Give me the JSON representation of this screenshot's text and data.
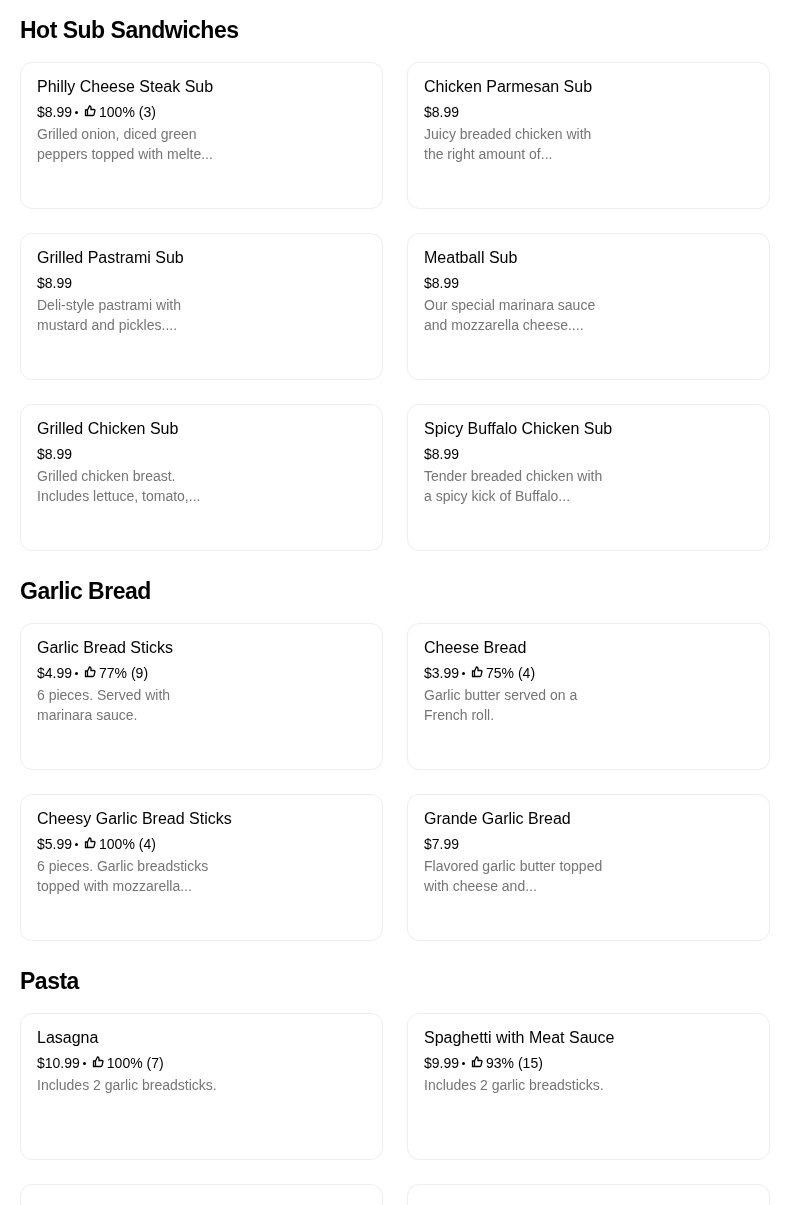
{
  "sections": [
    {
      "title": "Hot Sub Sandwiches",
      "items": [
        {
          "kind": "full",
          "name": "Philly Cheese Steak Sub",
          "price": "$8.99",
          "rating": "100% (3)",
          "description": "Grilled onion, diced green peppers topped with melte..."
        },
        {
          "kind": "full",
          "name": "Chicken Parmesan Sub",
          "price": "$8.99",
          "description": "Juicy breaded chicken with the right amount of..."
        },
        {
          "kind": "full",
          "name": "Grilled Pastrami Sub",
          "price": "$8.99",
          "description": "Deli-style pastrami with mustard and pickles...."
        },
        {
          "kind": "full",
          "name": "Meatball Sub",
          "price": "$8.99",
          "description": "Our special marinara sauce and mozzarella cheese...."
        },
        {
          "kind": "full",
          "name": "Grilled Chicken Sub",
          "price": "$8.99",
          "description": "Grilled chicken breast. Includes lettuce, tomato,..."
        },
        {
          "kind": "full",
          "name": "Spicy Buffalo Chicken Sub",
          "price": "$8.99",
          "description": "Tender breaded chicken with a spicy kick of Buffalo..."
        }
      ]
    },
    {
      "title": "Garlic Bread",
      "items": [
        {
          "kind": "full",
          "name": "Garlic Bread Sticks",
          "price": "$4.99",
          "rating": "77% (9)",
          "description": "6 pieces. Served with marinara sauce."
        },
        {
          "kind": "full",
          "name": "Cheese Bread",
          "price": "$3.99",
          "rating": "75% (4)",
          "description": "Garlic butter served on a French roll."
        },
        {
          "kind": "full",
          "name": "Cheesy Garlic Bread Sticks",
          "price": "$5.99",
          "rating": "100% (4)",
          "description": "6 pieces. Garlic breadsticks topped with mozzarella..."
        },
        {
          "kind": "full",
          "name": "Grande Garlic Bread",
          "price": "$7.99",
          "description": "Flavored garlic butter topped with cheese and..."
        }
      ]
    },
    {
      "title": "Pasta",
      "items": [
        {
          "kind": "full",
          "name": "Lasagna",
          "price": "$10.99",
          "rating": "100% (7)",
          "description": "Includes 2 garlic breadsticks."
        },
        {
          "kind": "full",
          "name": "Spaghetti with Meat Sauce",
          "price": "$9.99",
          "rating": "93% (15)",
          "description": "Includes 2 garlic breadsticks."
        },
        {
          "kind": "cut"
        },
        {
          "kind": "cut"
        }
      ]
    }
  ]
}
